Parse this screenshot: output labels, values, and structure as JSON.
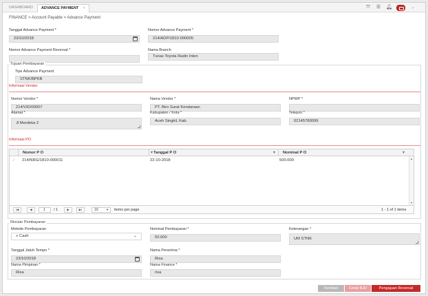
{
  "tabs": [
    {
      "label": "DASHBOARD"
    },
    {
      "label": "ADVANCE PAYMENT",
      "close": "×"
    }
  ],
  "breadcrumb": "FINANCE > Account Payable > Advance Payment",
  "header_fields": {
    "tanggal_label": "Tanggal Advance Payment *",
    "tanggal_value": "23/10/2018",
    "nomor_label": "Nomor Advance Payment *",
    "nomor_value": "214/ADP/1810-000005",
    "reversal_label": "Nomor Advance Payment Reversal *",
    "reversal_value": "",
    "branch_label": "Nama Branch",
    "branch_value": "Tunas Toyota Radin Inten"
  },
  "tujuan": {
    "section_title": "Tujuan Pembayaran",
    "tipe_label": "Tipe Advance Payment",
    "tipe_value": "STNK/BPKB"
  },
  "vendor": {
    "section_title": "Informasi Vendor",
    "nomor_label": "Nomor Vendor *",
    "nomor_value": "214/VID/00007",
    "nama_label": "Nama Vendor *",
    "nama_value": "PT. Biro Surat Kendaraan",
    "npwp_label": "NPWP *",
    "npwp_value": "",
    "alamat_label": "Alamat *",
    "alamat_value": "Jl Merdeka 2",
    "kab_label": "Kabupaten / Kota *",
    "kab_value": "Aceh Singkil, Kab.",
    "telepon_label": "Telepon *",
    "telepon_value": "02145780099"
  },
  "po": {
    "section_title": "Informasi PO",
    "columns": [
      "Nomor P O",
      "Tanggal P O",
      "Nominal P O"
    ],
    "rows": [
      {
        "nomor": "214/NRG/1810-000011",
        "tanggal": "22-10-2018",
        "nominal": "500.000"
      }
    ],
    "pager": {
      "first": "|◀",
      "prev": "◀",
      "page": "1",
      "of": "/ 1",
      "next": "▶",
      "last": "▶|",
      "per_page": "10",
      "per_page_label": "items per page",
      "summary": "1 - 1 of 1 items"
    }
  },
  "rincian": {
    "section_title": "Rincian Pembayaran",
    "metode_label": "Metode Pembayaran",
    "metode_value": "Cash",
    "nominal_label": "Nominal Pembayaran *",
    "nominal_value": "50.000",
    "keterangan_label": "Keterangan *",
    "keterangan_value": "UM STNK",
    "jatuh_tempo_label": "Tanggal Jatuh Tempo *",
    "jatuh_tempo_value": "23/10/2018",
    "penerima_label": "Nama Penerima *",
    "penerima_value": "Risa",
    "pimpinan_label": "Nama Pimpinan *",
    "pimpinan_value": "Risa",
    "finance_label": "Nama Finance *",
    "finance_value": "risa"
  },
  "buttons": {
    "kembali": "Kembali",
    "cetak": "Cetak BJD",
    "pengajuan": "Pengajuan Reversal"
  },
  "icons": {
    "expand": "expand-icon",
    "list": "list-icon",
    "bell": "bell-icon",
    "calendar": "calendar-icon",
    "search": "search-icon"
  },
  "colors": {
    "accent": "#c62828",
    "button_grey": "#b8b8b8",
    "button_pink": "#e8a0a0"
  }
}
